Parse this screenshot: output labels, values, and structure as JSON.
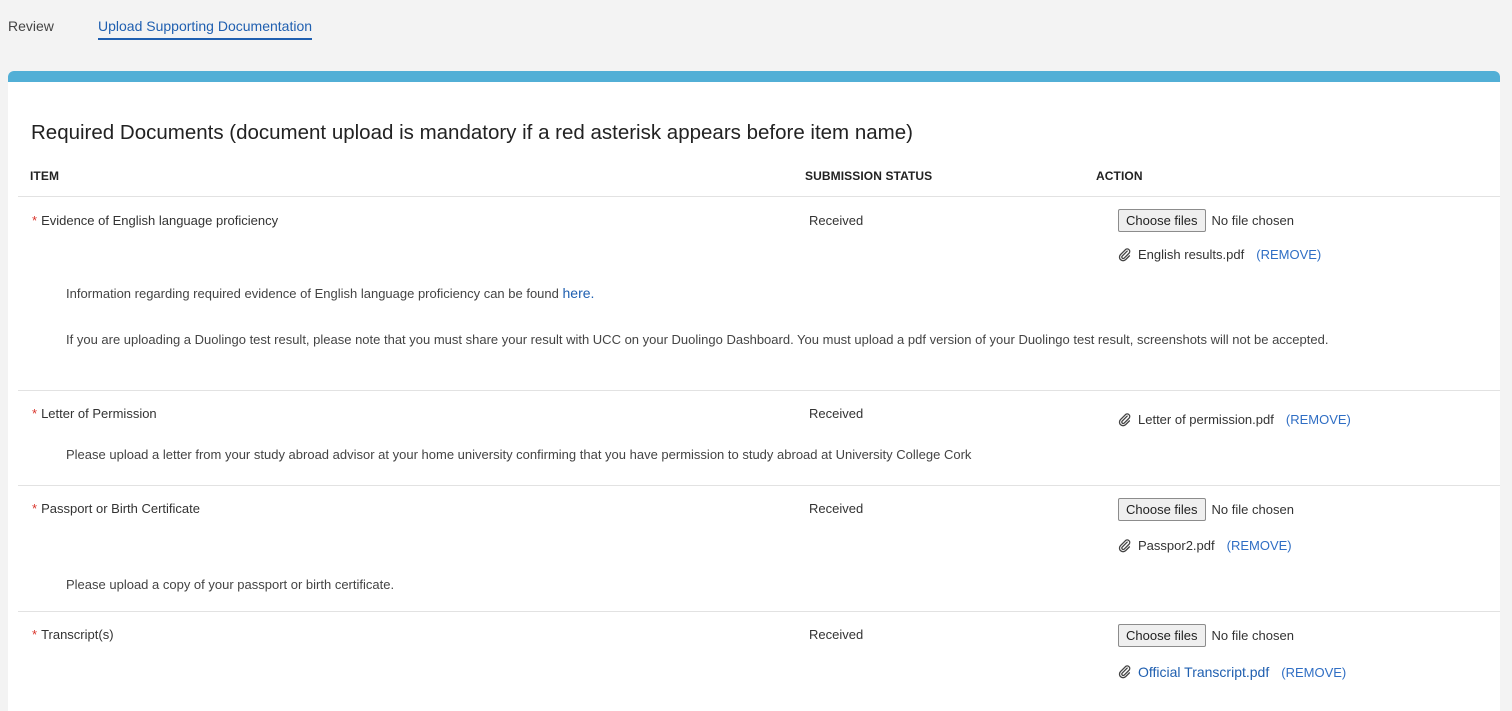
{
  "tabs": {
    "review": "Review",
    "upload": "Upload Supporting Documentation"
  },
  "section_title": "Required Documents (document upload is mandatory if a red asterisk appears before item name)",
  "headers": {
    "item": "ITEM",
    "status": "SUBMISSION STATUS",
    "action": "ACTION"
  },
  "required_marker": "*",
  "choose_files_label": "Choose files",
  "no_file_label": "No file chosen",
  "remove_label": "(REMOVE)",
  "rows": [
    {
      "item": "Evidence of English language proficiency",
      "status": "Received",
      "file": "English results.pdf",
      "desc1_text": "Information regarding required evidence of English language proficiency can be found",
      "desc1_link": "here.",
      "desc2": "If you are uploading a Duolingo test result, please note that you must share your result with UCC on your Duolingo Dashboard. You must upload a pdf version of your Duolingo test result, screenshots will not be accepted."
    },
    {
      "item": "Letter of Permission",
      "status": "Received",
      "file": "Letter of permission.pdf",
      "desc": "Please upload a letter from your study abroad advisor at your home university confirming that you have permission to study abroad at University College Cork"
    },
    {
      "item": "Passport or Birth Certificate",
      "status": "Received",
      "file": "Passpor2.pdf",
      "desc": "Please upload a copy of your passport or birth certificate."
    },
    {
      "item": "Transcript(s)",
      "status": "Received",
      "file": "Official Transcript.pdf"
    }
  ]
}
